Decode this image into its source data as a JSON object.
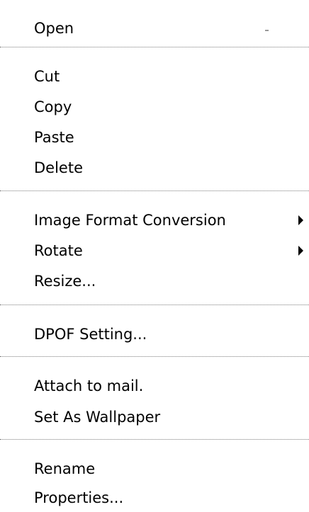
{
  "menu": {
    "items": [
      {
        "label": "Open"
      },
      {
        "label": "Cut"
      },
      {
        "label": "Copy"
      },
      {
        "label": "Paste"
      },
      {
        "label": "Delete"
      },
      {
        "label": "Image Format Conversion",
        "submenu_icon": "triangle-right-icon"
      },
      {
        "label": "Rotate",
        "submenu_icon": "triangle-right-icon"
      },
      {
        "label": "Resize..."
      },
      {
        "label": "DPOF Setting..."
      },
      {
        "label": "Attach to mail."
      },
      {
        "label": "Set As Wallpaper"
      },
      {
        "label": "Rename"
      },
      {
        "label": "Properties..."
      }
    ],
    "colors": {
      "background": "#ffffff",
      "text": "#000000",
      "separator": "#7d7d7d"
    }
  }
}
